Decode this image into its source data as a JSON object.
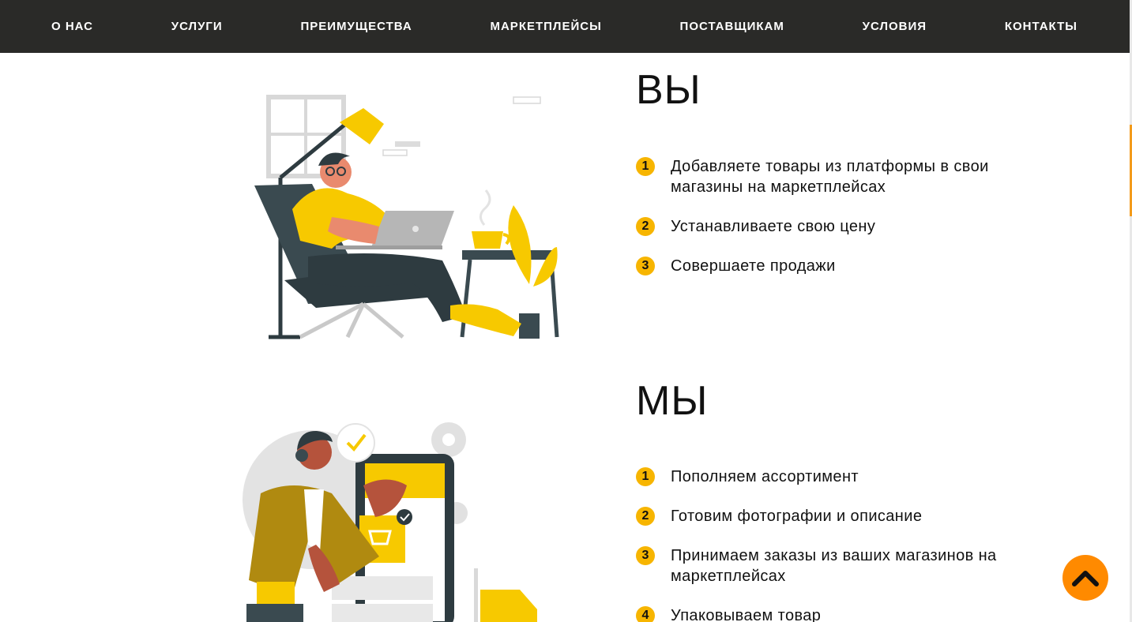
{
  "nav": {
    "items": [
      "О НАС",
      "УСЛУГИ",
      "ПРЕИМУЩЕСТВА",
      "МАРКЕТПЛЕЙСЫ",
      "ПОСТАВЩИКАМ",
      "УСЛОВИЯ",
      "КОНТАКТЫ"
    ]
  },
  "you": {
    "title": "ВЫ",
    "steps": [
      {
        "num": "1",
        "text": "Добавляете товары из платформы в свои магазины на маркетплейсах"
      },
      {
        "num": "2",
        "text": "Устанавливаете свою цену"
      },
      {
        "num": "3",
        "text": "Совершаете продажи"
      }
    ]
  },
  "we": {
    "title": "МЫ",
    "steps": [
      {
        "num": "1",
        "text": "Пополняем ассортимент"
      },
      {
        "num": "2",
        "text": "Готовим фотографии и описание"
      },
      {
        "num": "3",
        "text": "Принимаем заказы из ваших магазинов на маркетплейсах"
      },
      {
        "num": "4",
        "text": "Упаковываем товар"
      }
    ]
  },
  "colors": {
    "nav_bg": "#2a2a28",
    "accent_yellow": "#f7b500",
    "scroll_up": "#ff8a00"
  },
  "icons": {
    "scroll_up": "chevron-up-icon"
  }
}
